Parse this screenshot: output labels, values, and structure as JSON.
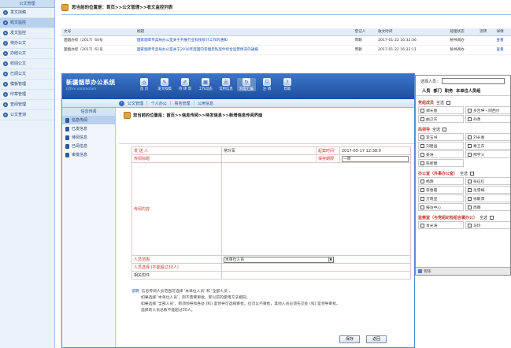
{
  "left_nav": {
    "title": "公文管理",
    "items": [
      "发文拟稿",
      "收文监控",
      "发文监控",
      "待办公文",
      "办结公文",
      "收阅公文",
      "已阅公文",
      "模板管理",
      "印章管理",
      "查阅管理",
      "公文查询"
    ],
    "active_index": 1
  },
  "back_window": {
    "breadcrumb": "您当前的位置是：首页>>公文管理>>收文监控列表",
    "columns": [
      "文号",
      "标题",
      "登记人",
      "收文时间",
      "处理状态",
      "流转",
      "详情"
    ],
    "rows": [
      {
        "no": "国烟办综〔2017〕60号",
        "title": "国家烟草专卖局办公室关于开展行业科技统计工作的通知",
        "reg": "周颖",
        "time": "2017-01-22 16:32:36",
        "status": "秘书阅办",
        "flow": "",
        "detail": "查看"
      },
      {
        "no": "国烟办综〔2017〕61号",
        "title": "国家烟草专卖局办公室关于2016年度国内卷烟走私案件综合运营情况的通报",
        "reg": "周颖",
        "time": "2017-01-22 16:32:11",
        "status": "秘书阅办",
        "flow": "",
        "detail": "查看"
      }
    ]
  },
  "app": {
    "title": "新疆烟草办公系统",
    "subtitle": "Office automation",
    "toolbar": [
      "首 页",
      "发文拟稿",
      "待 转 等",
      "工作动态",
      "常用信息",
      "制度汇编",
      "注 销",
      "帮助"
    ],
    "toolbar_icons": [
      "home-icon",
      "document-icon",
      "edit-icon",
      "grid-icon",
      "book-icon",
      "refresh-icon",
      "logout-icon",
      "help-icon"
    ],
    "toolbar_active_index": 5,
    "subnav": [
      "公文管理",
      "个人办公",
      "事务管理",
      "公用信息"
    ]
  },
  "inner_side": {
    "title": "信息传阅",
    "items": [
      "信息传阅",
      "已发信息",
      "待阅信息",
      "已阅信息",
      "审批信息"
    ],
    "active_index": 0
  },
  "form": {
    "breadcrumb": "您当前的位置是：首页>>信息传阅>>待发信息>>新增信息传阅界面",
    "sender_label": "发 送 人",
    "sender_value": "常玲军",
    "send_time_label": "起案时间",
    "send_time_value": "2017-05-17 12:38:0",
    "title_label": "传阅标题",
    "keep_label": "保存期限",
    "keep_value": "一周",
    "content_label": "传阅内容",
    "scope_label": "人员范围",
    "scope_value": "本单位人员",
    "people_label": "人员选择 (不能超过30人)",
    "attach_label": "相关附件",
    "note_title": "说明",
    "notes": [
      "信息传阅人员范围可选择 '本单位人员' 和 '全部人员'，",
      "如果选择 '本单位人员'，则不需要审批，即以前的使用方法相同。",
      "如果选择 '全部人员'，则须领导和各处 (科) 室领导可选择审批，也可以不审批，其他人员必须先交处 (科) 室领导审批。",
      "选择的人员总数不能超过30人。"
    ],
    "save_button": "保存",
    "back_button": "返回"
  },
  "people_panel": {
    "select_label": "选择人员：",
    "tabs": [
      "人员",
      "部门",
      "职务",
      "本单位人员组"
    ],
    "select_all": "全选",
    "groups": [
      {
        "name": "党组成员",
        "people": [
          "郑长春",
          "多吉坤・阿西尔",
          "曲卫东",
          "孙勇"
        ]
      },
      {
        "name": "局领导",
        "people": [
          "李玉书",
          "刘长春",
          "刘建昌",
          "秦卫东",
          "姜涛",
          "邢学义",
          "陈新健"
        ]
      },
      {
        "name": "办公室（外事办公室）",
        "people": [
          "杨晓",
          "张征红",
          "李春霞",
          "毛雪梅",
          "万晓宜",
          "徐毅萍",
          "报访中心",
          "周颖"
        ]
      },
      {
        "name": "监察室（与党组纪检组合署办公）",
        "people": [
          "肖光涛",
          "马玲"
        ]
      }
    ],
    "status": "完毕"
  }
}
